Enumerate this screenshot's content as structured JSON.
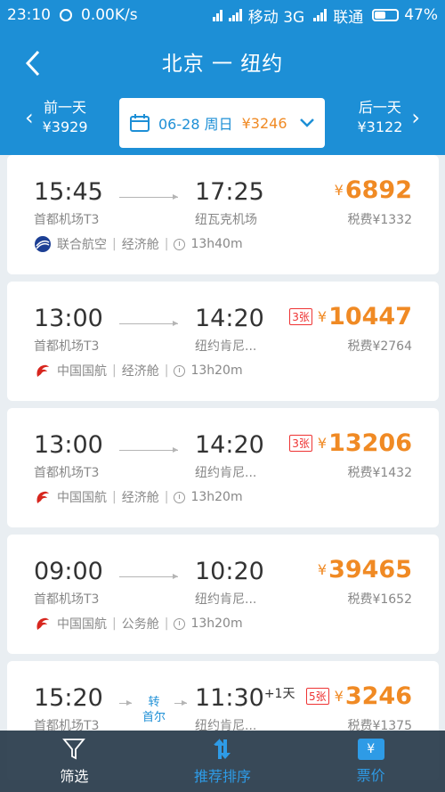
{
  "status_bar": {
    "time": "23:10",
    "speed": "0.00K/s",
    "carrier1": "移动 3G",
    "carrier2": "联通",
    "battery": "47%"
  },
  "header": {
    "title": "北京 一 纽约",
    "prev_label": "前一天",
    "prev_price": "¥3929",
    "next_label": "后一天",
    "next_price": "¥3122",
    "date": "06-28 周日",
    "date_price": "¥3246"
  },
  "flights": [
    {
      "dep_time": "15:45",
      "arr_time": "17:25",
      "plus_day": "",
      "dep_airport": "首都机场T3",
      "arr_airport": "纽瓦克机场",
      "airline": "联合航空",
      "cabin": "经济舱",
      "duration": "13h40m",
      "tickets": "",
      "yen": "¥",
      "price": "6892",
      "tax": "税费¥1332",
      "transfer": "",
      "transfer_city": "",
      "logo": "united"
    },
    {
      "dep_time": "13:00",
      "arr_time": "14:20",
      "plus_day": "",
      "dep_airport": "首都机场T3",
      "arr_airport": "纽约肯尼...",
      "airline": "中国国航",
      "cabin": "经济舱",
      "duration": "13h20m",
      "tickets": "3张",
      "yen": "¥",
      "price": "10447",
      "tax": "税费¥2764",
      "transfer": "",
      "transfer_city": "",
      "logo": "airchina"
    },
    {
      "dep_time": "13:00",
      "arr_time": "14:20",
      "plus_day": "",
      "dep_airport": "首都机场T3",
      "arr_airport": "纽约肯尼...",
      "airline": "中国国航",
      "cabin": "经济舱",
      "duration": "13h20m",
      "tickets": "3张",
      "yen": "¥",
      "price": "13206",
      "tax": "税费¥1432",
      "transfer": "",
      "transfer_city": "",
      "logo": "airchina"
    },
    {
      "dep_time": "09:00",
      "arr_time": "10:20",
      "plus_day": "",
      "dep_airport": "首都机场T3",
      "arr_airport": "纽约肯尼...",
      "airline": "中国国航",
      "cabin": "公务舱",
      "duration": "13h20m",
      "tickets": "",
      "yen": "¥",
      "price": "39465",
      "tax": "税费¥1652",
      "transfer": "",
      "transfer_city": "",
      "logo": "airchina"
    },
    {
      "dep_time": "15:20",
      "arr_time": "11:30",
      "plus_day": "+1天",
      "dep_airport": "首都机场T3",
      "arr_airport": "纽约肯尼...",
      "airline": "",
      "cabin": "",
      "duration": "",
      "tickets": "5张",
      "yen": "¥",
      "price": "3246",
      "tax": "税费¥1375",
      "transfer": "转",
      "transfer_city": "首尔",
      "logo": ""
    }
  ],
  "tabbar": {
    "filter": "筛选",
    "sort": "推荐排序",
    "price": "票价",
    "price_icon": "¥"
  },
  "colors": {
    "primary": "#1d8fd6",
    "price": "#f08a24",
    "tickets": "#ee3333"
  }
}
